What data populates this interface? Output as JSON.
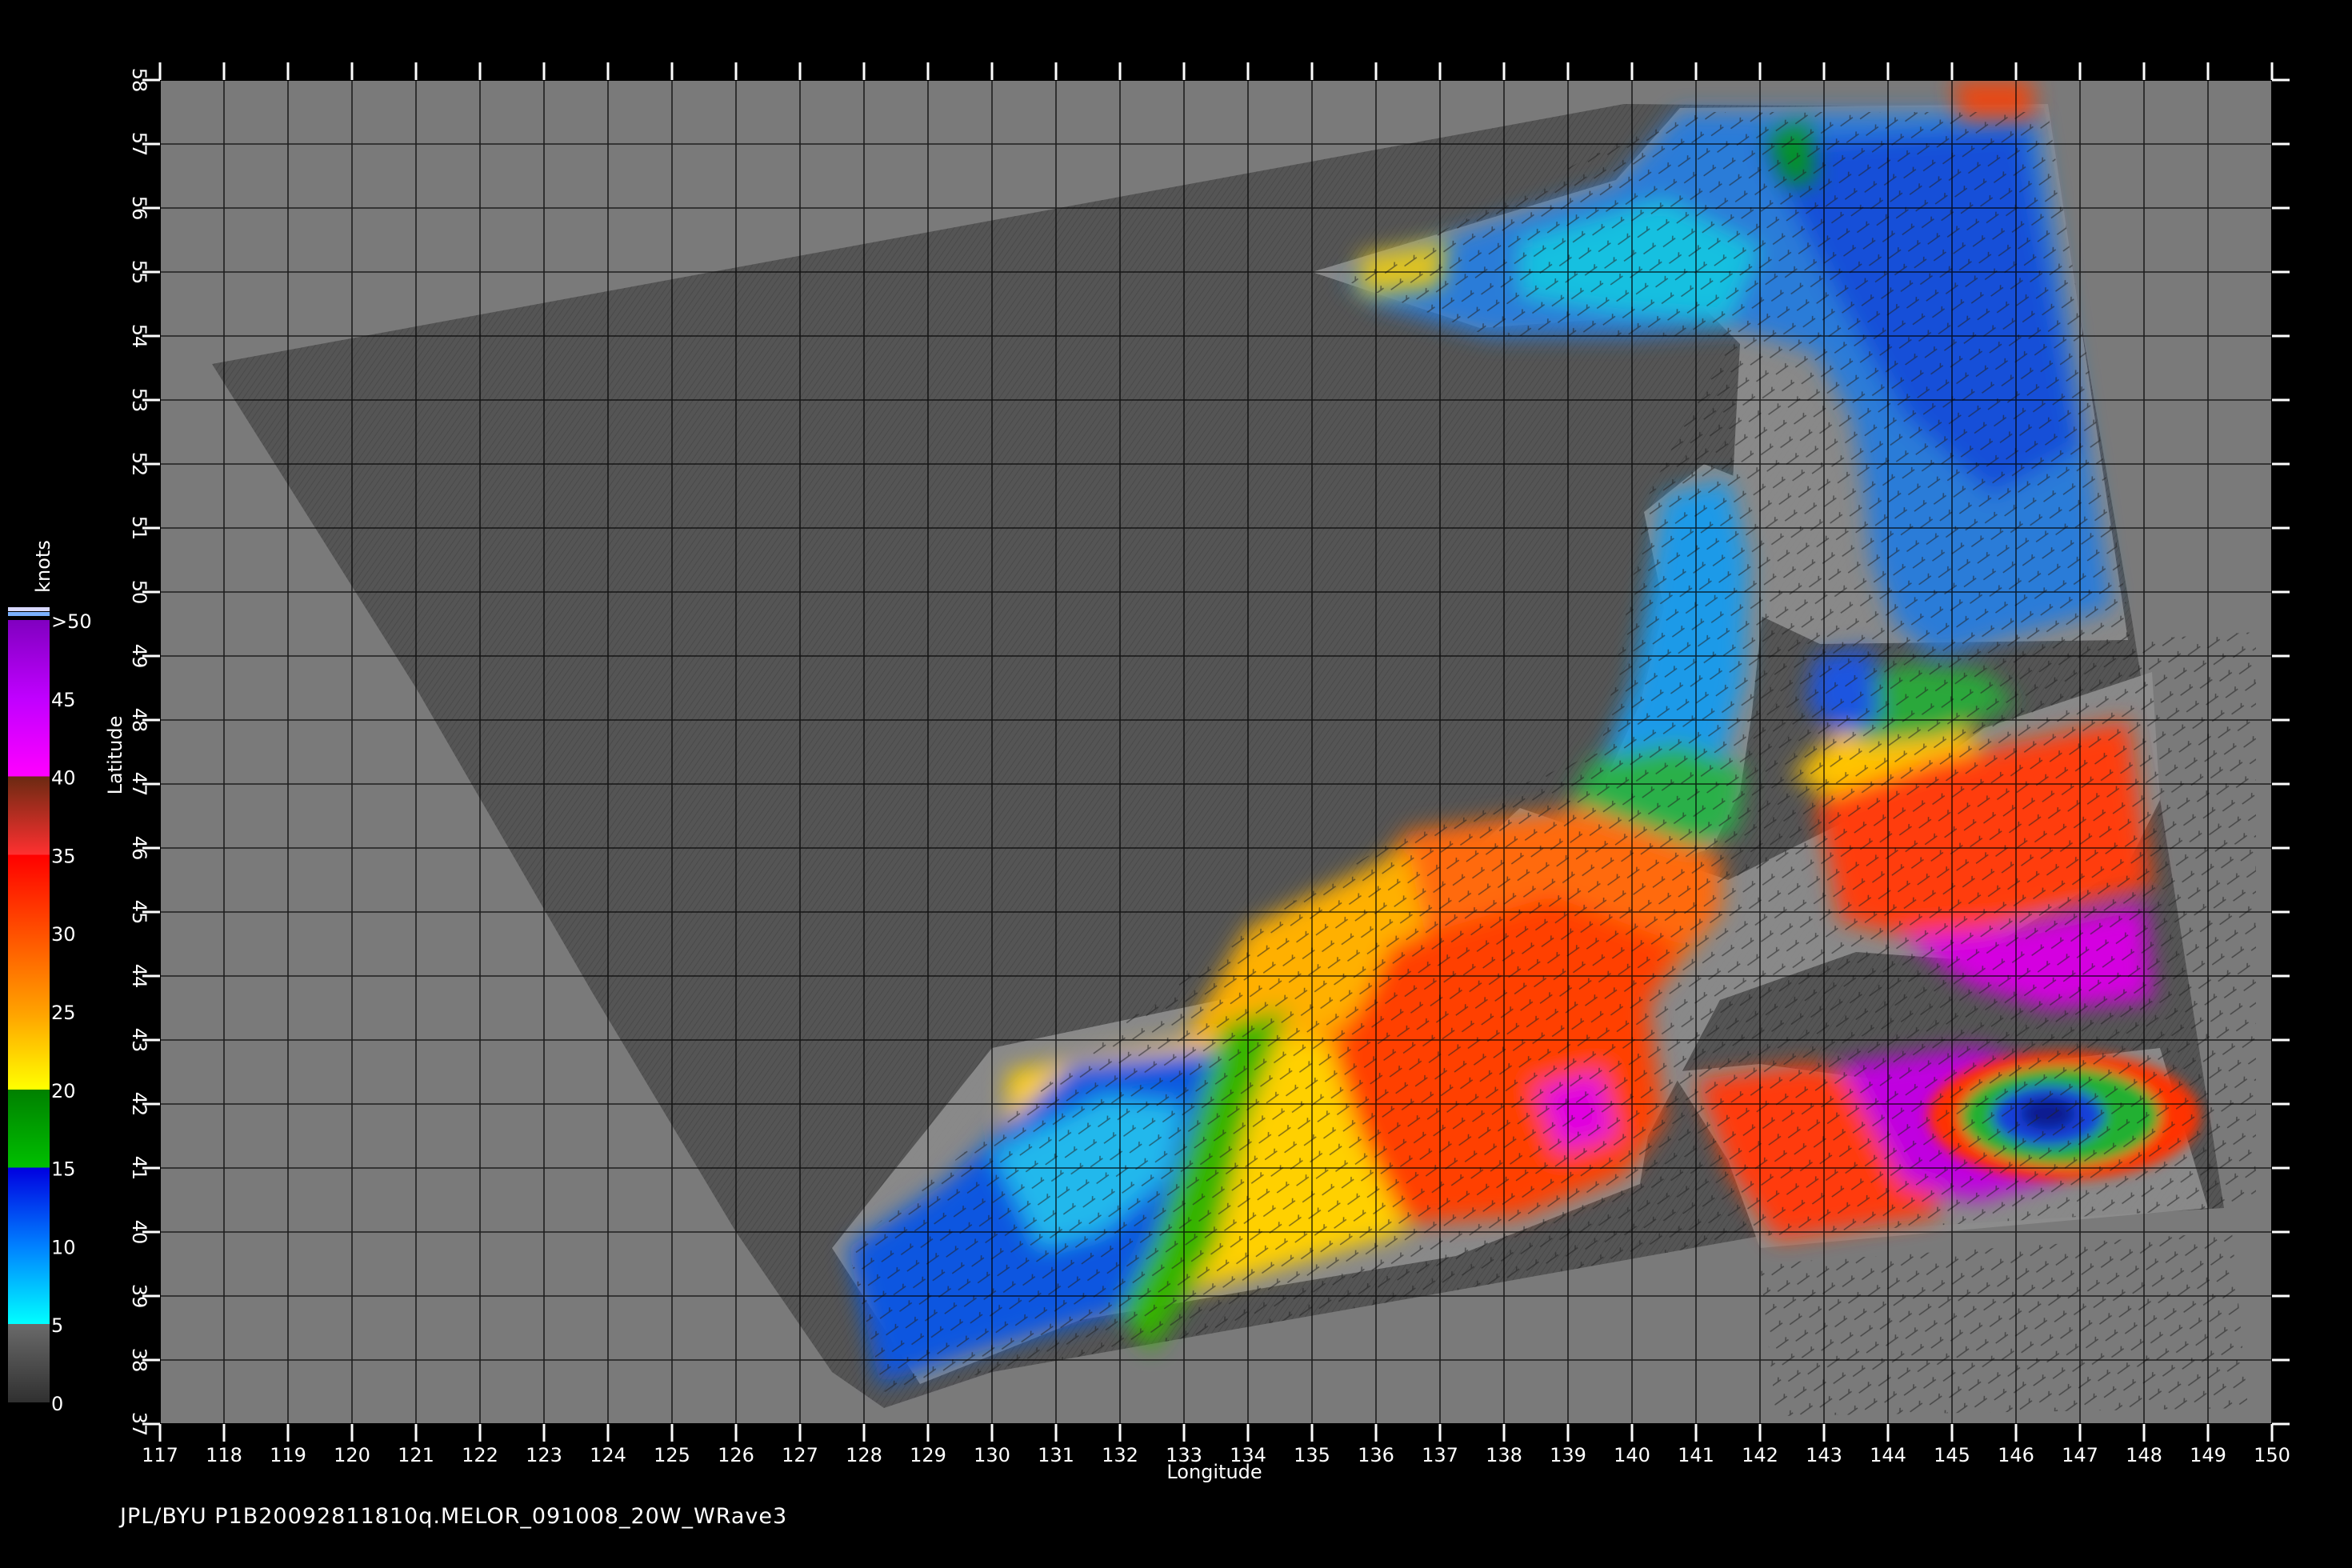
{
  "map": {
    "type": "wind-speed-map",
    "lon_range": [
      117,
      150
    ],
    "lat_range": [
      37,
      58
    ],
    "lon_ticks": [
      "117",
      "118",
      "119",
      "120",
      "121",
      "122",
      "123",
      "124",
      "125",
      "126",
      "127",
      "128",
      "129",
      "130",
      "131",
      "132",
      "133",
      "134",
      "135",
      "136",
      "137",
      "138",
      "139",
      "140",
      "141",
      "142",
      "143",
      "144",
      "145",
      "146",
      "147",
      "148",
      "149",
      "150"
    ],
    "lat_ticks": [
      "37",
      "38",
      "39",
      "40",
      "41",
      "42",
      "43",
      "44",
      "45",
      "46",
      "47",
      "48",
      "49",
      "50",
      "51",
      "52",
      "53",
      "54",
      "55",
      "56",
      "57",
      "58"
    ],
    "xlabel": "Longitude",
    "ylabel": "Latitude",
    "grid": true,
    "colors": {
      "background": "#000000",
      "land": "#7a7a7a",
      "swath": "#555555",
      "coast": "#8c8c8c"
    }
  },
  "colorbar": {
    "unit": "knots",
    "labels": [
      "0",
      "5",
      "10",
      "15",
      "20",
      "25",
      "30",
      "35",
      "40",
      "45",
      ">50"
    ],
    "stops": [
      {
        "v": 0,
        "color": "#303030"
      },
      {
        "v": 5,
        "color": "#6a6a6a"
      },
      {
        "v": 5,
        "color": "#00ffff"
      },
      {
        "v": 10,
        "color": "#0080ff"
      },
      {
        "v": 15,
        "color": "#0000e0"
      },
      {
        "v": 15,
        "color": "#00c000"
      },
      {
        "v": 20,
        "color": "#008000"
      },
      {
        "v": 20,
        "color": "#ffff00"
      },
      {
        "v": 25,
        "color": "#ffa000"
      },
      {
        "v": 30,
        "color": "#ff5000"
      },
      {
        "v": 35,
        "color": "#ff0000"
      },
      {
        "v": 35,
        "color": "#ff3030"
      },
      {
        "v": 40,
        "color": "#6b2a12"
      },
      {
        "v": 40,
        "color": "#ff00ff"
      },
      {
        "v": 45,
        "color": "#c000ff"
      },
      {
        "v": 50,
        "color": "#8000c0"
      }
    ]
  },
  "footer": {
    "caption": "JPL/BYU  P1B20092811810q.MELOR_091008_20W_WRave3"
  }
}
